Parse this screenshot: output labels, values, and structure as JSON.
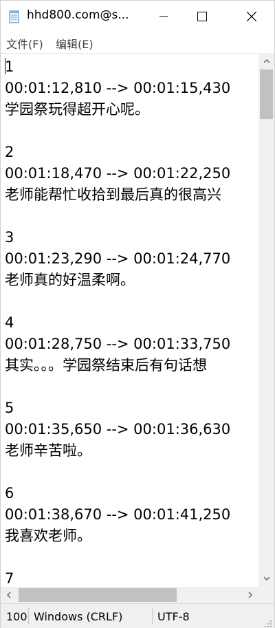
{
  "window": {
    "title": "hhd800.com@s...",
    "icon": "notepad-icon"
  },
  "menu": {
    "file": "文件(F)",
    "edit": "编辑(E)"
  },
  "editor": {
    "lines": [
      "1",
      "00:01:12,810 --> 00:01:15,430",
      "学园祭玩得超开心呢。",
      "",
      "2",
      "00:01:18,470 --> 00:01:22,250",
      "老师能帮忙收拾到最后真的很高兴",
      "",
      "3",
      "00:01:23,290 --> 00:01:24,770",
      "老师真的好温柔啊。",
      "",
      "4",
      "00:01:28,750 --> 00:01:33,750",
      "其实。。。学园祭结束后有句话想",
      "",
      "5",
      "00:01:35,650 --> 00:01:36,630",
      "老师辛苦啦。",
      "",
      "6",
      "00:01:38,670 --> 00:01:41,250",
      "我喜欢老师。",
      "",
      "7"
    ]
  },
  "status": {
    "zoom": "100",
    "line_ending": "Windows (CRLF)",
    "encoding": "UTF-8"
  },
  "colors": {
    "scrollbar_track": "#f0f0f0",
    "scrollbar_thumb": "#c1c1c1",
    "statusbar_bg": "#f0f0f0"
  }
}
